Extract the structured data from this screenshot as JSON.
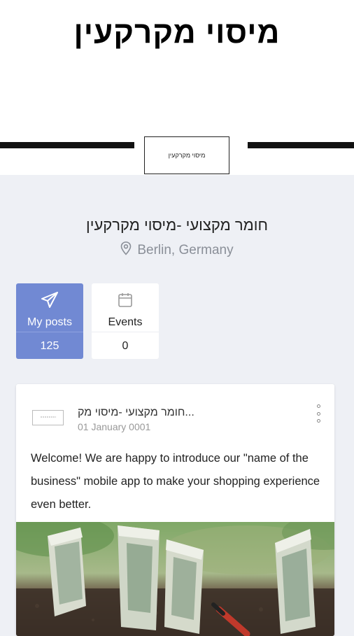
{
  "header": {
    "cover_title": "מיסוי מקרקעין",
    "avatar_text": "מיסוי מקרקעין"
  },
  "profile": {
    "name": "חומר מקצועי -מיסוי מקרקעין",
    "location": "Berlin, Germany",
    "location_icon": "map-pin-icon"
  },
  "stats": {
    "posts": {
      "label": "My posts",
      "count": "125",
      "icon": "paper-plane-icon"
    },
    "events": {
      "label": "Events",
      "count": "0",
      "icon": "calendar-icon"
    }
  },
  "post": {
    "author": "חומר מקצועי -מיסוי מק...",
    "date": "01 January 0001",
    "text": "Welcome! We are happy to introduce our \"name of the business\" mobile app to make your shopping experience even better.",
    "menu_icon": "more-vertical-icon",
    "image_icon": "money-plants-photo"
  },
  "colors": {
    "accent": "#7189d3",
    "background": "#eef0f5"
  }
}
